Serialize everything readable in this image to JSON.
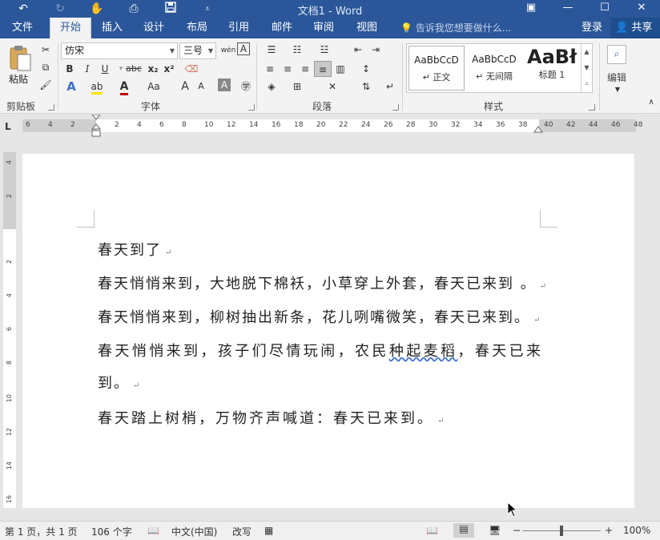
{
  "window": {
    "title": "文档1 - Word",
    "controls": [
      "minimize-icon",
      "maximize-icon",
      "close-icon"
    ]
  },
  "qat": {
    "icons": [
      "undo-icon",
      "redo-icon",
      "touch-mode-icon",
      "print-preview-icon",
      "save-icon",
      "customize-icon"
    ]
  },
  "tabs": [
    {
      "label": "文件"
    },
    {
      "label": "开始",
      "active": true
    },
    {
      "label": "插入"
    },
    {
      "label": "设计"
    },
    {
      "label": "布局"
    },
    {
      "label": "引用"
    },
    {
      "label": "邮件"
    },
    {
      "label": "审阅"
    },
    {
      "label": "视图"
    }
  ],
  "tell_me": "告诉我您想要做什么...",
  "account": {
    "login": "登录",
    "share": "共享"
  },
  "ribbon": {
    "clipboard": {
      "label": "剪贴板",
      "paste": "粘贴"
    },
    "font": {
      "label": "字体",
      "name": "仿宋",
      "size": "三号",
      "bold": "B",
      "italic": "I",
      "underline": "U",
      "strike": "abc",
      "subscript": "x₂",
      "superscript": "x²",
      "aa": "Aa",
      "grow": "A",
      "shrink": "A",
      "wen": "wén",
      "clear": "A"
    },
    "paragraph": {
      "label": "段落"
    },
    "styles": {
      "label": "样式",
      "items": [
        {
          "sample": "AaBbCcD",
          "name": "正文"
        },
        {
          "sample": "AaBbCcD",
          "name": "无间隔"
        },
        {
          "sample": "AaBł",
          "name": "标题 1"
        }
      ]
    },
    "editing": {
      "label": "编辑"
    }
  },
  "ruler": {
    "h_left": [
      "6",
      "4",
      "2"
    ],
    "h_main": [
      "2",
      "4",
      "6",
      "8",
      "10",
      "12",
      "14",
      "16",
      "18",
      "20",
      "22",
      "24",
      "26",
      "28",
      "30",
      "32",
      "34",
      "36",
      "38"
    ],
    "h_right": [
      "40",
      "42",
      "44",
      "46",
      "48"
    ],
    "v_top": [
      "4",
      "2"
    ],
    "v_main": [
      "2",
      "4",
      "6",
      "8",
      "10",
      "12",
      "14",
      "16"
    ]
  },
  "document": {
    "lines": [
      "春天到了",
      "春天悄悄来到，大地脱下棉袄，小草穿上外套，春天已来到 。",
      "春天悄悄来到，柳树抽出新条，花儿咧嘴微笑，春天已来到。",
      "春天悄悄来到，孩子们尽情玩闹，农民种起麦稻，春天已来",
      "到。",
      "春天踏上树梢，万物齐声喊道：春天已来到。"
    ],
    "para_mark": "↵"
  },
  "status": {
    "page": "第 1 页，共 1 页",
    "words": "106 个字",
    "language": "中文(中国)",
    "mode": "改写",
    "zoom": "100%",
    "zoom_minus": "−",
    "zoom_plus": "+"
  }
}
